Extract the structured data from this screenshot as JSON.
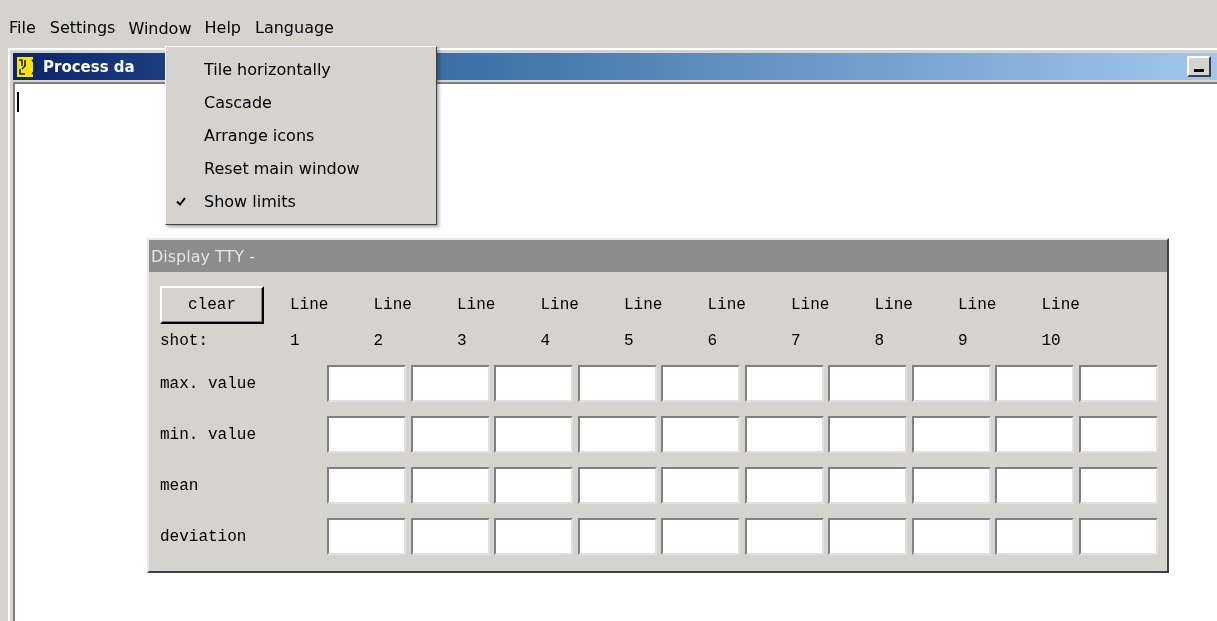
{
  "menu_bar": [
    {
      "label": "File",
      "selected": false
    },
    {
      "label": "Settings",
      "selected": false
    },
    {
      "label": "Window",
      "selected": true
    },
    {
      "label": "Help",
      "selected": false
    },
    {
      "label": "Language",
      "selected": false
    }
  ],
  "window_menu": [
    {
      "label": "Tile horizontally",
      "checked": false
    },
    {
      "label": "Cascade",
      "checked": false
    },
    {
      "label": "Arrange icons",
      "checked": false
    },
    {
      "label": "Reset main window",
      "checked": false
    },
    {
      "label": "Show limits",
      "checked": true
    }
  ],
  "main_window": {
    "title": "Process da"
  },
  "display_window": {
    "title": "Display TTY -",
    "clear_button": "clear",
    "shot_label": "shot:",
    "columns": [
      {
        "label": "Line",
        "number": "1"
      },
      {
        "label": "Line",
        "number": "2"
      },
      {
        "label": "Line",
        "number": "3"
      },
      {
        "label": "Line",
        "number": "4"
      },
      {
        "label": "Line",
        "number": "5"
      },
      {
        "label": "Line",
        "number": "6"
      },
      {
        "label": "Line",
        "number": "7"
      },
      {
        "label": "Line",
        "number": "8"
      },
      {
        "label": "Line",
        "number": "9"
      },
      {
        "label": "Line",
        "number": "10"
      }
    ],
    "rows": [
      "max. value",
      "min. value",
      "mean",
      "deviation"
    ]
  }
}
